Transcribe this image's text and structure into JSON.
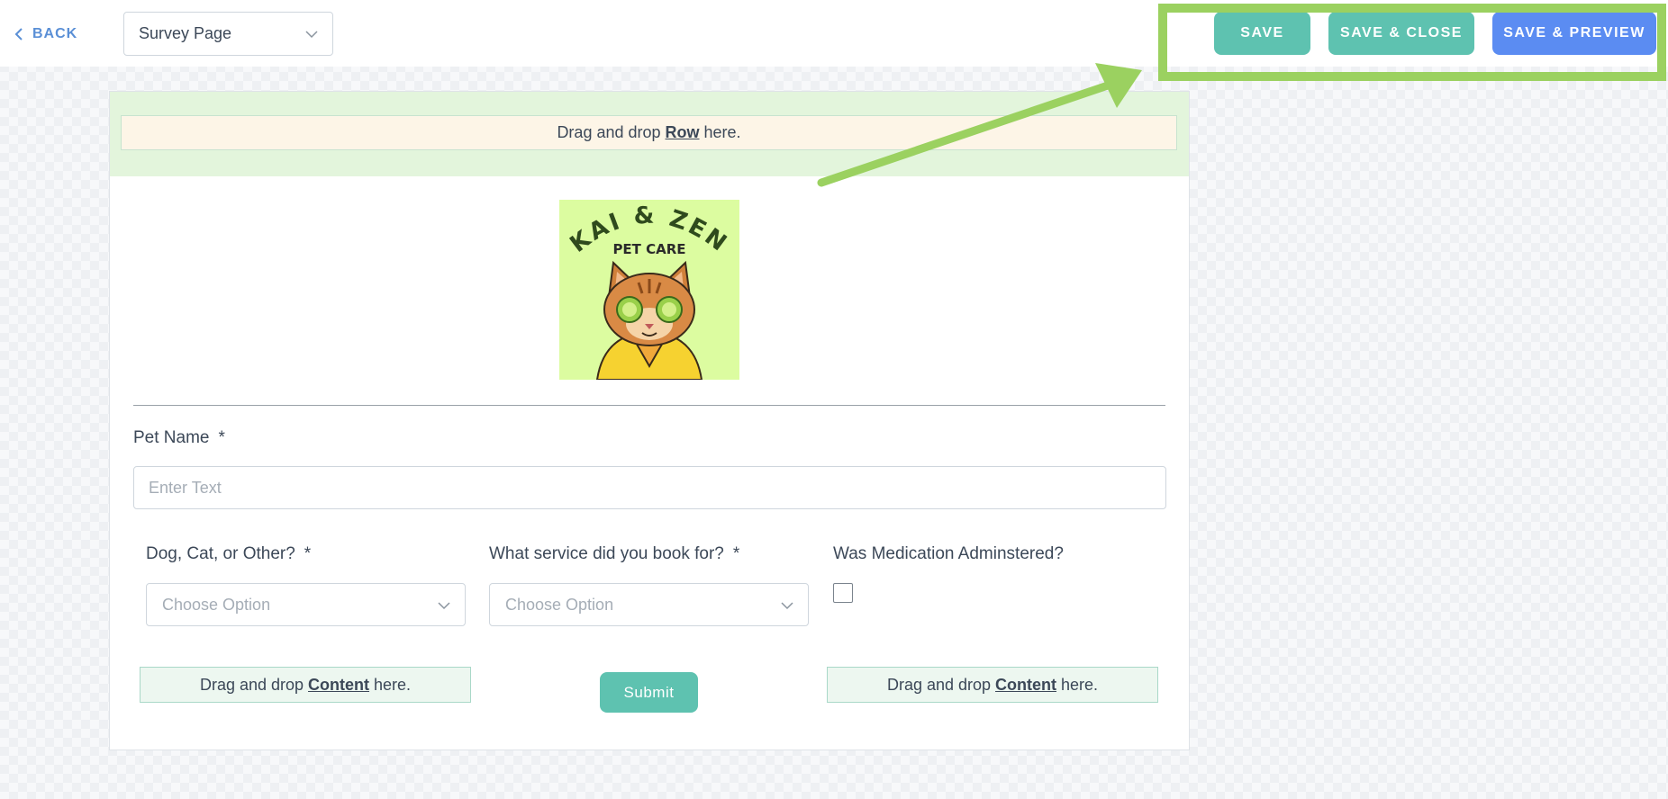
{
  "topbar": {
    "back_label": "BACK",
    "page_selector": "Survey Page",
    "save_label": "SAVE",
    "save_close_label": "SAVE & CLOSE",
    "save_preview_label": "SAVE & PREVIEW"
  },
  "canvas": {
    "row_drop": {
      "prefix": "Drag and drop",
      "keyword": "Row",
      "suffix": "here."
    },
    "logo": {
      "line1": "KAI & ZEN",
      "line2": "PET CARE"
    },
    "fields": {
      "pet_name": {
        "label": "Pet Name",
        "required": "*",
        "placeholder": "Enter Text"
      },
      "animal_type": {
        "label": "Dog, Cat, or Other?",
        "required": "*",
        "placeholder": "Choose Option"
      },
      "service": {
        "label": "What service did you book for?",
        "required": "*",
        "placeholder": "Choose Option"
      },
      "medication": {
        "label": "Was Medication Adminstered?"
      }
    },
    "content_drop": {
      "prefix": "Drag and drop",
      "keyword": "Content",
      "suffix": "here."
    },
    "submit_label": "Submit"
  },
  "colors": {
    "accent_teal": "#5ec2b0",
    "accent_blue": "#5b8cf2",
    "highlight_green": "#9bd160",
    "link_blue": "#5a8fd6"
  },
  "icons": [
    "chevron-left-icon",
    "chevron-down-icon",
    "arrow-annotation"
  ]
}
